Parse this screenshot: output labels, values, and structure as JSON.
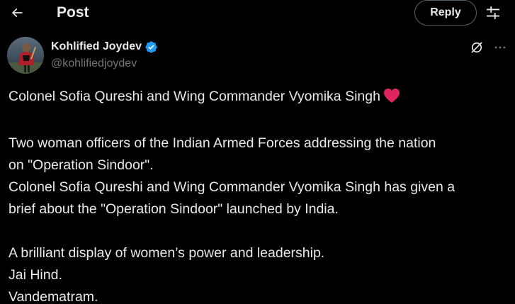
{
  "header": {
    "title": "Post",
    "reply_label": "Reply"
  },
  "author": {
    "display_name": "Kohlified Joydev",
    "handle": "@kohlifiedjoydev",
    "verified": true
  },
  "post": {
    "line1": "Colonel Sofia Qureshi and Wing Commander Vyomika Singh",
    "line2": "Two woman officers of the Indian Armed Forces addressing the nation",
    "line3": "on \"Operation Sindoor\".",
    "line4": "Colonel Sofia Qureshi and Wing Commander Vyomika Singh has given a",
    "line5": "brief about the \"Operation Sindoor\" launched by India.",
    "line6": "A brilliant display of women’s power and leadership.",
    "line7": "Jai Hind.",
    "line8": "Vandematram."
  },
  "icons": {
    "back": "arrow-left-icon",
    "settings": "sliders-icon",
    "verified": "verified-badge-icon",
    "grok": "grok-icon",
    "more": "more-horizontal-icon",
    "heart": "red-heart-emoji"
  },
  "colors": {
    "background": "#000000",
    "text": "#e7e9ea",
    "secondary_text": "#71767b",
    "verified_blue": "#1d9bf0",
    "heart_red": "#e0245e",
    "border": "#536471"
  }
}
